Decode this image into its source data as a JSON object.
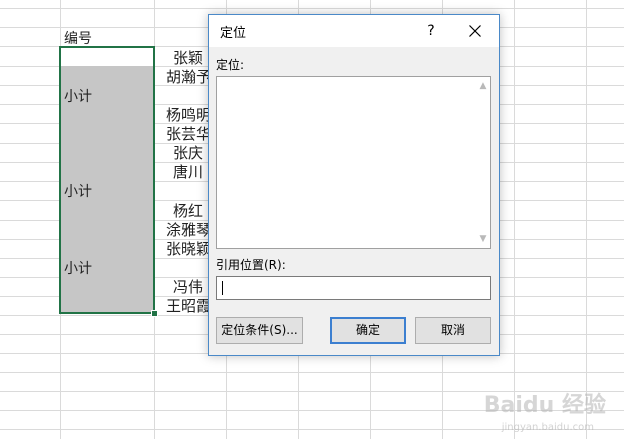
{
  "sheet": {
    "header_cell": "编号",
    "subtotal_label": "小计",
    "names": [
      "张颖",
      "胡瀚予",
      "杨鸣明",
      "张芸华",
      "张庆",
      "唐川",
      "杨红",
      "涂雅琴",
      "张晓颖",
      "冯伟",
      "王昭霞"
    ]
  },
  "dialog": {
    "title": "定位",
    "help_label": "?",
    "goto_label": "定位:",
    "reference_label": "引用位置(R):",
    "reference_value": "",
    "special_button": "定位条件(S)...",
    "ok_button": "确定",
    "cancel_button": "取消"
  },
  "watermark": {
    "brand": "Baidu 经验",
    "url": "jingyan.baidu.com"
  },
  "colors": {
    "selection_border": "#217346",
    "selection_fill": "#c6c6c6",
    "dialog_border": "#4a89c8",
    "default_button_border": "#3c7fd0"
  }
}
